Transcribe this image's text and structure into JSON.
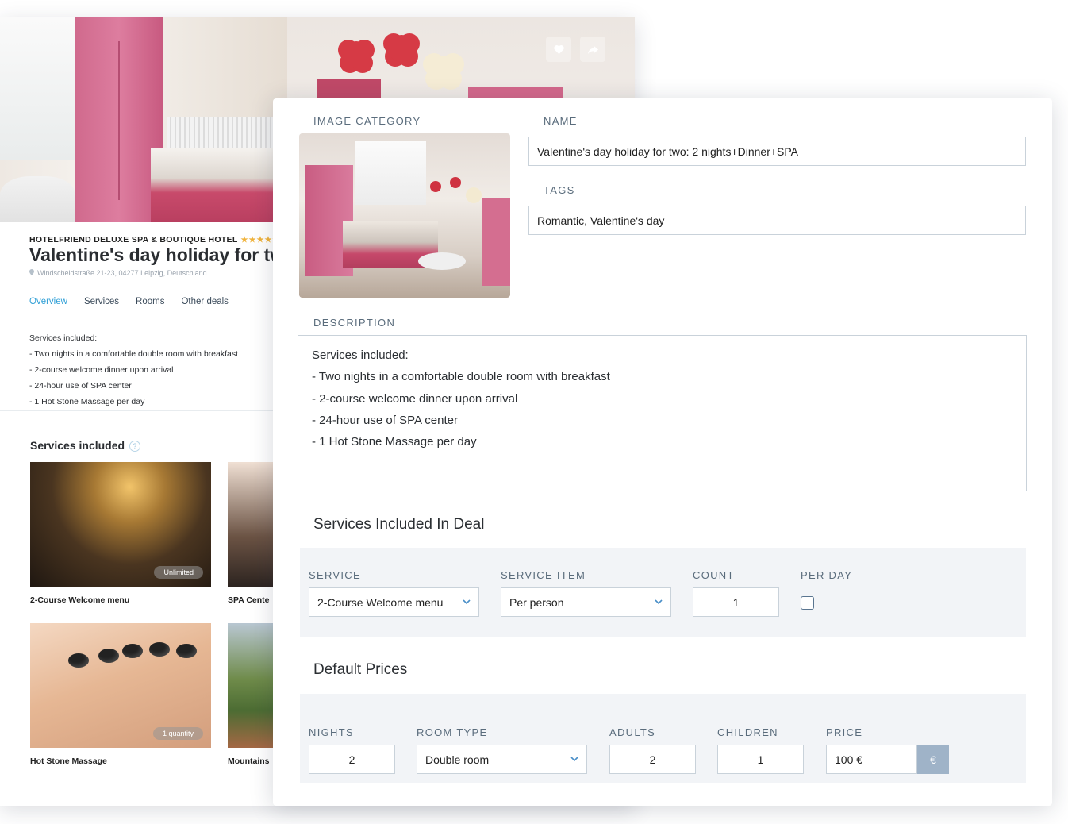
{
  "hotel_page": {
    "hotel_name": "HOTELFRIEND DELUXE SPA & BOUTIQUE HOTEL",
    "stars": "★★★★★",
    "deal_title": "Valentine's day holiday for tw",
    "address": "Windscheidstraße 21-23, 04277 Leipzig, Deutschland",
    "tabs": [
      {
        "label": "Overview",
        "active": true
      },
      {
        "label": "Services",
        "active": false
      },
      {
        "label": "Rooms",
        "active": false
      },
      {
        "label": "Other deals",
        "active": false
      }
    ],
    "description_lines": [
      "Services included:",
      "- Two nights in a comfortable double room with breakfast",
      "- 2-course welcome dinner upon arrival",
      "- 24-hour use of SPA center",
      "- 1 Hot Stone Massage per day"
    ],
    "services_title": "Services included",
    "help_glyph": "?",
    "services": [
      {
        "label": "2-Course Welcome menu",
        "badge": "Unlimited"
      },
      {
        "label": "SPA Cente",
        "badge": ""
      },
      {
        "label": "Hot Stone Massage",
        "badge": "1 quantity"
      },
      {
        "label": "Mountains",
        "badge": ""
      }
    ],
    "icons": {
      "favorite": "heart-icon",
      "share": "share-icon",
      "location": "map-pin-icon"
    }
  },
  "edit_panel": {
    "image_category_label": "IMAGE CATEGORY",
    "name_label": "NAME",
    "name_value": "Valentine's day holiday for two: 2 nights+Dinner+SPA",
    "tags_label": "TAGS",
    "tags_value": "Romantic, Valentine's day",
    "description_label": "DESCRIPTION",
    "description_lines": [
      "Services included:",
      "- Two nights in a comfortable double room with breakfast",
      "- 2-course welcome dinner upon arrival",
      "- 24-hour use of SPA center",
      "- 1 Hot Stone Massage per day"
    ],
    "services_section": {
      "title": "Services Included In Deal",
      "service_label": "SERVICE",
      "service_value": "2-Course Welcome menu",
      "service_item_label": "SERVICE ITEM",
      "service_item_value": "Per person",
      "count_label": "COUNT",
      "count_value": "1",
      "per_day_label": "PER DAY",
      "per_day_checked": false
    },
    "prices_section": {
      "title": "Default Prices",
      "nights_label": "NIGHTS",
      "nights_value": "2",
      "room_type_label": "ROOM TYPE",
      "room_type_value": "Double room",
      "adults_label": "ADULTS",
      "adults_value": "2",
      "children_label": "CHILDREN",
      "children_value": "1",
      "price_label": "PRICE",
      "price_value": "100 €",
      "currency_symbol": "€"
    }
  },
  "colors": {
    "accent_blue": "#2f9fd6",
    "star_gold": "#f0b33c",
    "label_gray": "#5a6c7c",
    "section_bg": "#f2f4f7",
    "currency_button": "#9fb3c8"
  }
}
